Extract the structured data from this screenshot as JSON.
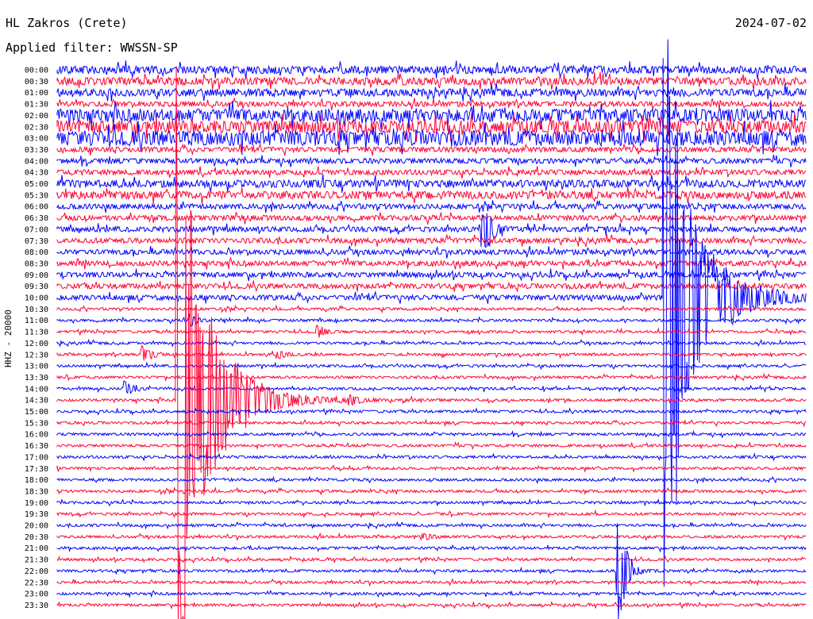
{
  "header": {
    "station": "HL Zakros (Crete)",
    "date": "2024-07-02",
    "filter": "Applied filter: WWSSN-SP"
  },
  "channel_label": "HHZ - 20000",
  "colors": {
    "odd": "#0000ff",
    "even": "#ff0033"
  },
  "chart_data": {
    "type": "helicorder",
    "title": "HL Zakros (Crete)",
    "subtitle": "Applied filter: WWSSN-SP",
    "ylabel": "HHZ - 20000",
    "rows": [
      "00:00",
      "00:30",
      "01:00",
      "01:30",
      "02:00",
      "02:30",
      "03:00",
      "03:30",
      "04:00",
      "04:30",
      "05:00",
      "05:30",
      "06:00",
      "06:30",
      "07:00",
      "07:30",
      "08:00",
      "08:30",
      "09:00",
      "09:30",
      "10:00",
      "10:30",
      "11:00",
      "11:30",
      "12:00",
      "12:30",
      "13:00",
      "13:30",
      "14:00",
      "14:30",
      "15:00",
      "15:30",
      "16:00",
      "16:30",
      "17:00",
      "17:30",
      "18:00",
      "18:30",
      "19:00",
      "19:30",
      "20:00",
      "20:30",
      "21:00",
      "21:30",
      "22:00",
      "22:30",
      "23:00",
      "23:30"
    ],
    "row_minutes": 30,
    "noise_level_by_row": [
      3,
      3,
      3,
      2,
      5,
      5,
      6,
      2,
      2,
      2,
      3,
      3,
      2,
      2,
      2,
      2,
      2,
      2,
      2,
      2,
      2,
      1,
      1,
      1,
      1,
      1,
      1,
      1,
      1,
      1,
      1,
      1,
      1,
      1,
      1,
      1,
      1,
      1,
      1,
      1,
      1,
      1,
      1,
      1,
      1,
      1,
      1,
      1
    ],
    "events": [
      {
        "row": "07:00",
        "minute": 17.0,
        "amplitude": 40
      },
      {
        "row": "11:00",
        "minute": 5.3,
        "amplitude": 8
      },
      {
        "row": "11:30",
        "minute": 10.4,
        "amplitude": 8
      },
      {
        "row": "12:30",
        "minute": 3.4,
        "amplitude": 12
      },
      {
        "row": "12:30",
        "minute": 8.8,
        "amplitude": 6
      },
      {
        "row": "14:00",
        "minute": 2.7,
        "amplitude": 10
      },
      {
        "row": "14:30",
        "minute": 11.7,
        "amplitude": 7
      },
      {
        "row": "14:30",
        "minute": 4.8,
        "amplitude": 500,
        "label": "large earthquake"
      },
      {
        "row": "10:00",
        "minute": 24.3,
        "amplitude": 420,
        "label": "large earthquake"
      },
      {
        "row": "22:00",
        "minute": 22.4,
        "amplitude": 80
      },
      {
        "row": "20:30",
        "minute": 14.6,
        "amplitude": 6
      }
    ]
  }
}
